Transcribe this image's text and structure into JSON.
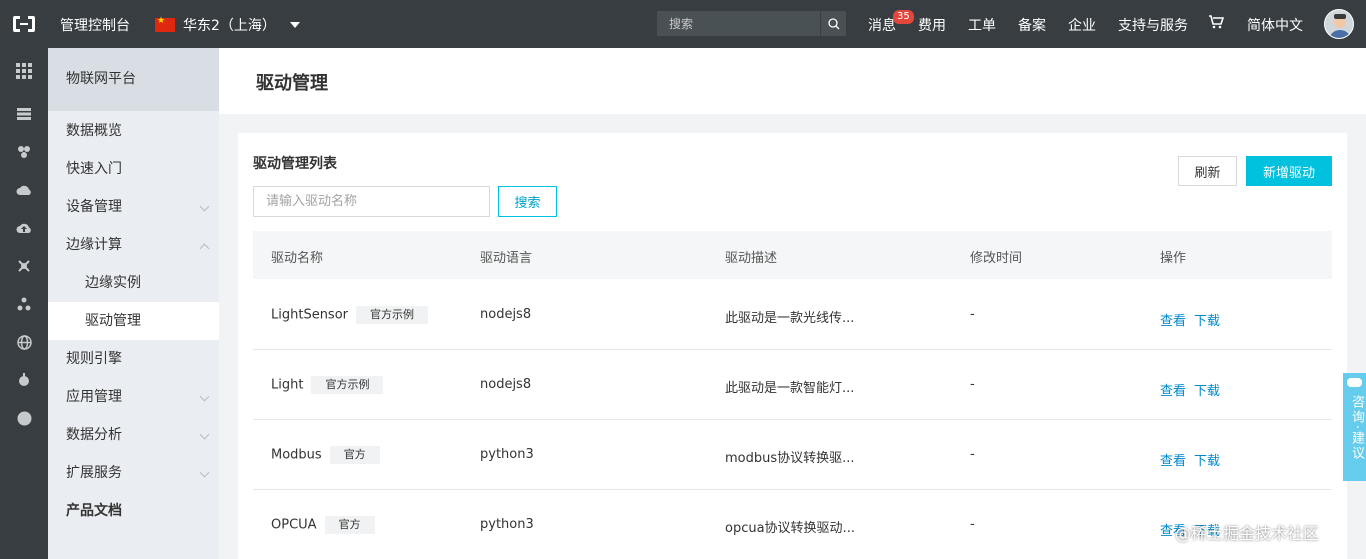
{
  "topbar": {
    "console_label": "管理控制台",
    "region": "华东2（上海）",
    "search_placeholder": "搜索",
    "nav": {
      "messages": "消息",
      "messages_badge": "35",
      "billing": "费用",
      "tickets": "工单",
      "icp": "备案",
      "enterprise": "企业",
      "support": "支持与服务",
      "language": "简体中文"
    }
  },
  "sidebar": {
    "title": "物联网平台",
    "items": [
      {
        "label": "数据概览"
      },
      {
        "label": "快速入门"
      },
      {
        "label": "设备管理"
      },
      {
        "label": "边缘计算"
      },
      {
        "label": "边缘实例"
      },
      {
        "label": "驱动管理"
      },
      {
        "label": "规则引擎"
      },
      {
        "label": "应用管理"
      },
      {
        "label": "数据分析"
      },
      {
        "label": "扩展服务"
      },
      {
        "label": "产品文档"
      }
    ]
  },
  "page": {
    "title": "驱动管理",
    "list_title": "驱动管理列表",
    "search_placeholder": "请输入驱动名称",
    "search_button": "搜索",
    "refresh_button": "刷新",
    "add_button": "新增驱动"
  },
  "table": {
    "columns": [
      "驱动名称",
      "驱动语言",
      "驱动描述",
      "修改时间",
      "操作"
    ],
    "rows": [
      {
        "name": "LightSensor",
        "tag": "官方示例",
        "language": "nodejs8",
        "description": "此驱动是一款光线传...",
        "modified": "-",
        "view": "查看",
        "download": "下载"
      },
      {
        "name": "Light",
        "tag": "官方示例",
        "language": "nodejs8",
        "description": "此驱动是一款智能灯...",
        "modified": "-",
        "view": "查看",
        "download": "下载"
      },
      {
        "name": "Modbus",
        "tag": "官方",
        "language": "python3",
        "description": "modbus协议转换驱...",
        "modified": "-",
        "view": "查看",
        "download": "下载"
      },
      {
        "name": "OPCUA",
        "tag": "官方",
        "language": "python3",
        "description": "opcua协议转换驱动...",
        "modified": "-",
        "view": "查看",
        "download": "下载"
      }
    ]
  },
  "feedback": {
    "label": "咨询·建议"
  },
  "watermark": "@稀土掘金技术社区",
  "colors": {
    "accent": "#00c1de",
    "link": "#0088cc",
    "topbar": "#373d41",
    "badge": "#e2473b"
  }
}
